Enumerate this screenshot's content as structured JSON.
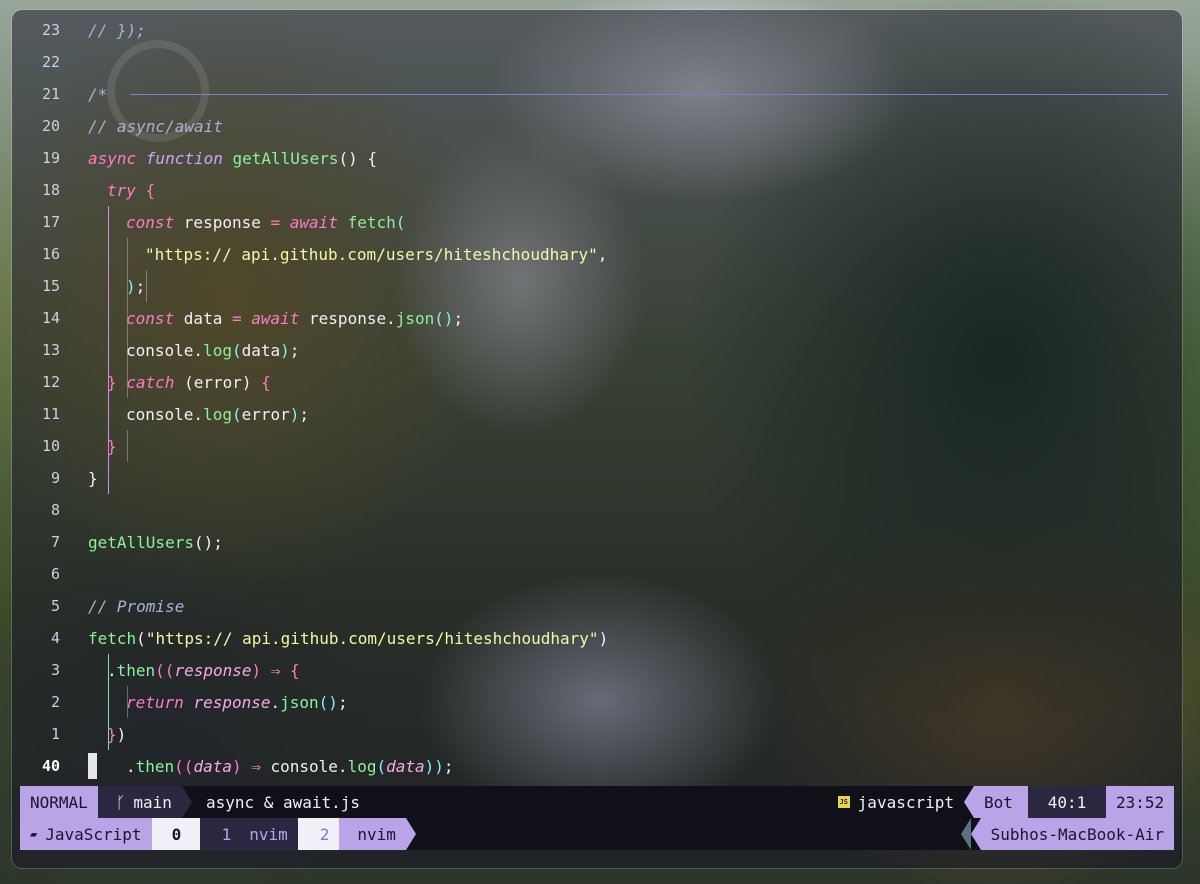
{
  "editor": {
    "lines": [
      {
        "num": "23",
        "tokens": [
          [
            "com",
            "// });"
          ]
        ]
      },
      {
        "num": "22",
        "tokens": []
      },
      {
        "num": "21",
        "tokens": [
          [
            "com",
            "/*"
          ]
        ]
      },
      {
        "num": "20",
        "tokens": [
          [
            "com",
            "// async/await"
          ]
        ]
      },
      {
        "num": "19",
        "tokens": [
          [
            "kw",
            "async "
          ],
          [
            "fnkw",
            "function "
          ],
          [
            "fn",
            "getAllUsers"
          ],
          [
            "brk",
            "() {"
          ]
        ]
      },
      {
        "num": "18",
        "tokens": [
          [
            "kw",
            "try "
          ],
          [
            "brk2",
            "{"
          ]
        ]
      },
      {
        "num": "17",
        "tokens": [
          [
            "kw",
            "const "
          ],
          [
            "id",
            "response "
          ],
          [
            "op",
            "= "
          ],
          [
            "kw",
            "await "
          ],
          [
            "fn",
            "fetch"
          ],
          [
            "brk3",
            "("
          ]
        ]
      },
      {
        "num": "16",
        "tokens": [
          [
            "str",
            "\"https:// api.github.com/users/hiteshchoudhary\""
          ],
          [
            "id",
            ","
          ]
        ]
      },
      {
        "num": "15",
        "tokens": [
          [
            "brk3",
            ")"
          ],
          [
            "id",
            ";"
          ]
        ]
      },
      {
        "num": "14",
        "tokens": [
          [
            "kw",
            "const "
          ],
          [
            "id",
            "data "
          ],
          [
            "op",
            "= "
          ],
          [
            "kw",
            "await "
          ],
          [
            "id",
            "response."
          ],
          [
            "fn",
            "json"
          ],
          [
            "brk3",
            "()"
          ],
          [
            "id",
            ";"
          ]
        ]
      },
      {
        "num": "13",
        "tokens": [
          [
            "id",
            "console."
          ],
          [
            "fn",
            "log"
          ],
          [
            "brk3",
            "("
          ],
          [
            "id",
            "data"
          ],
          [
            "brk3",
            ")"
          ],
          [
            "id",
            ";"
          ]
        ]
      },
      {
        "num": "12",
        "tokens": [
          [
            "brk2",
            "} "
          ],
          [
            "kw",
            "catch "
          ],
          [
            "id",
            "(error) "
          ],
          [
            "brk2",
            "{"
          ]
        ]
      },
      {
        "num": "11",
        "tokens": [
          [
            "id",
            "console."
          ],
          [
            "fn",
            "log"
          ],
          [
            "brk3",
            "("
          ],
          [
            "id",
            "error"
          ],
          [
            "brk3",
            ")"
          ],
          [
            "id",
            ";"
          ]
        ]
      },
      {
        "num": "10",
        "tokens": [
          [
            "brk2",
            "}"
          ]
        ]
      },
      {
        "num": "9",
        "tokens": [
          [
            "brk",
            "}"
          ]
        ]
      },
      {
        "num": "8",
        "tokens": []
      },
      {
        "num": "7",
        "tokens": [
          [
            "fn",
            "getAllUsers"
          ],
          [
            "id",
            "();"
          ]
        ]
      },
      {
        "num": "6",
        "tokens": []
      },
      {
        "num": "5",
        "tokens": [
          [
            "com",
            "// Promise"
          ]
        ]
      },
      {
        "num": "4",
        "tokens": [
          [
            "fn",
            "fetch"
          ],
          [
            "id",
            "("
          ],
          [
            "str",
            "\"https:// api.github.com/users/hiteshchoudhary\""
          ],
          [
            "id",
            ")"
          ]
        ]
      },
      {
        "num": "3",
        "tokens": [
          [
            "id",
            "."
          ],
          [
            "fn",
            "then"
          ],
          [
            "brk2",
            "(("
          ],
          [
            "par",
            "response"
          ],
          [
            "brk2",
            ") "
          ],
          [
            "op",
            "⇒ "
          ],
          [
            "brk2",
            "{"
          ]
        ]
      },
      {
        "num": "2",
        "tokens": [
          [
            "kw",
            "return "
          ],
          [
            "par",
            "response"
          ],
          [
            "id",
            "."
          ],
          [
            "fn",
            "json"
          ],
          [
            "brk3",
            "()"
          ],
          [
            "id",
            ";"
          ]
        ]
      },
      {
        "num": "1",
        "tokens": [
          [
            "brk2",
            "}"
          ],
          [
            "id",
            ")"
          ]
        ]
      },
      {
        "num": "40",
        "tokens": [
          [
            "id",
            "."
          ],
          [
            "fn",
            "then"
          ],
          [
            "brk2",
            "(("
          ],
          [
            "par",
            "data"
          ],
          [
            "brk2",
            ") "
          ],
          [
            "op",
            "⇒ "
          ],
          [
            "id",
            "console."
          ],
          [
            "fn",
            "log"
          ],
          [
            "brk3",
            "("
          ],
          [
            "par",
            "data"
          ],
          [
            "brk3",
            "))"
          ],
          [
            "id",
            ";"
          ]
        ]
      }
    ]
  },
  "statusline": {
    "mode": "NORMAL",
    "branch_icon": "git-branch-icon",
    "branch_glyph": "ᚴ",
    "branch": "main",
    "filename": "async & await.js",
    "filetype_icon": "js-file-icon",
    "filetype_glyph": "JS",
    "filetype": "javascript",
    "scroll": "Bot",
    "position": "40:1",
    "time": "23:52"
  },
  "tabline": {
    "lang_glyph": "▰",
    "lang": "JavaScript",
    "tab0": "0",
    "tab1_num": "1",
    "tab1_name": "nvim",
    "tab2_num": "2",
    "tab2_name": "nvim",
    "host": "Subhos-MacBook-Air"
  },
  "colors": {
    "mode_bg": "#b9a4e8",
    "statusline_bg": "#0f1018",
    "keyword": "#ff79c6",
    "function": "#8bf29a",
    "string": "#f6f7a8",
    "comment": "#aab0d6"
  }
}
